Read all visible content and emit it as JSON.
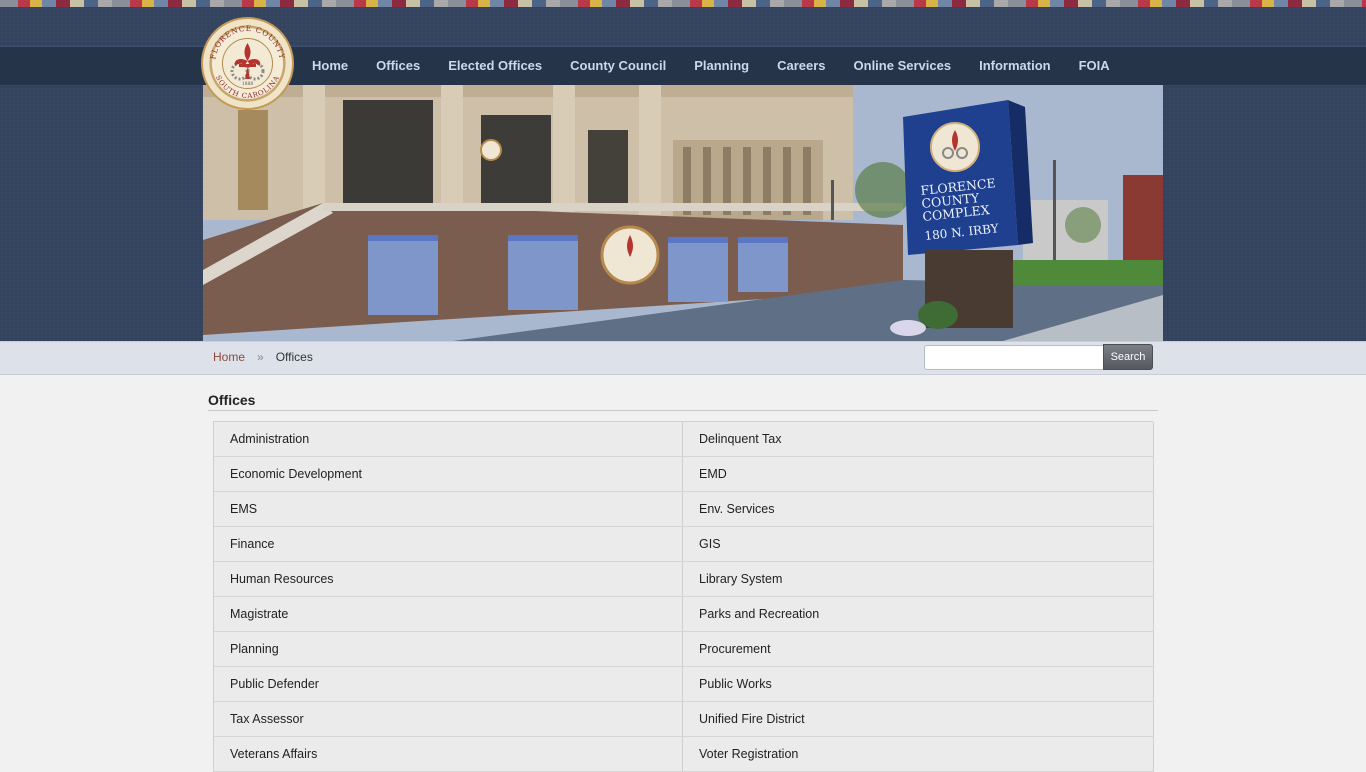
{
  "seal": {
    "top_text": "FLORENCE COUNTY",
    "bottom_text": "SOUTH CAROLINA",
    "year": "1888"
  },
  "nav": {
    "items": [
      "Home",
      "Offices",
      "Elected Offices",
      "County Council",
      "Planning",
      "Careers",
      "Online Services",
      "Information",
      "FOIA"
    ]
  },
  "hero": {
    "sign_line1": "FLORENCE",
    "sign_line2": "COUNTY",
    "sign_line3": "COMPLEX",
    "sign_address": "180 N. IRBY"
  },
  "breadcrumb": {
    "home": "Home",
    "separator": "»",
    "current": "Offices"
  },
  "search": {
    "placeholder": "",
    "button_label": "Search"
  },
  "section": {
    "title": "Offices"
  },
  "offices": [
    "Administration",
    "Delinquent Tax",
    "Economic Development",
    "EMD",
    "EMS",
    "Env. Services",
    "Finance",
    "GIS",
    "Human Resources",
    "Library System",
    "Magistrate",
    "Parks and Recreation",
    "Planning",
    "Procurement",
    "Public Defender",
    "Public Works",
    "Tax Assessor",
    "Unified Fire District",
    "Veterans Affairs",
    "Voter Registration"
  ],
  "colors": {
    "masthead": "#34445e",
    "navbar": "#26344a",
    "nav_text": "#c9d8ee",
    "breadcrumb_link": "#8a4a3a",
    "cell_bg": "#ebebeb"
  }
}
